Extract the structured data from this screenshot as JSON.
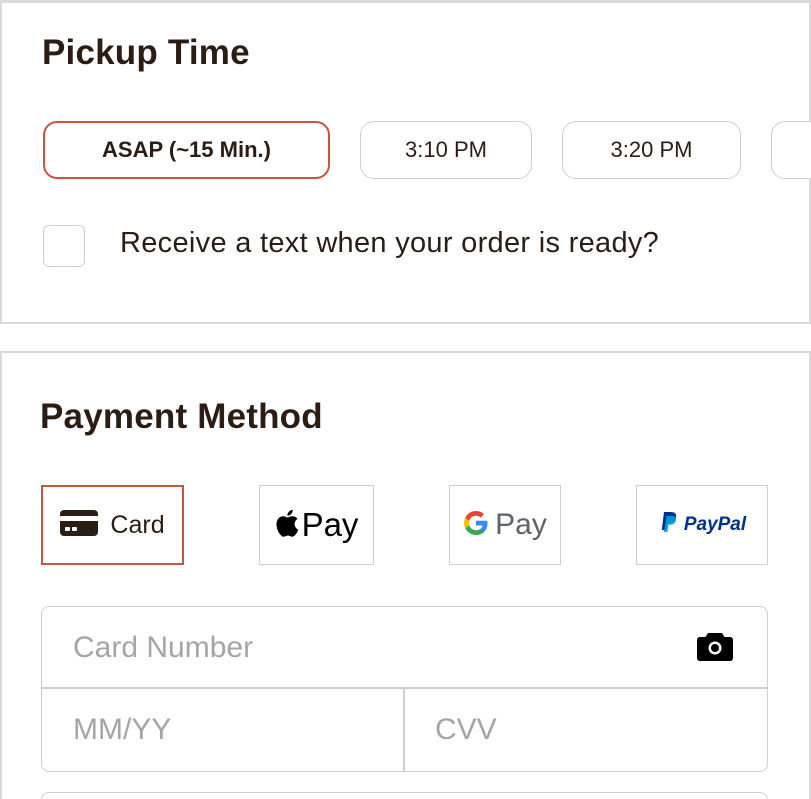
{
  "pickup": {
    "title": "Pickup Time",
    "options": [
      {
        "label": "ASAP (~15 Min.)",
        "selected": true
      },
      {
        "label": "3:10 PM",
        "selected": false
      },
      {
        "label": "3:20 PM",
        "selected": false
      },
      {
        "label": "",
        "selected": false
      }
    ],
    "text_notification_label": "Receive a text when your order is ready?",
    "text_notification_checked": false
  },
  "payment": {
    "title": "Payment Method",
    "methods": [
      {
        "id": "card",
        "label": "Card",
        "icon": "credit-card-icon",
        "selected": true
      },
      {
        "id": "apple_pay",
        "label": "Pay",
        "icon": "apple-logo-icon",
        "selected": false
      },
      {
        "id": "google_pay",
        "label": "Pay",
        "icon": "google-logo-icon",
        "selected": false
      },
      {
        "id": "paypal",
        "label": "PayPal",
        "icon": "paypal-logo-icon",
        "selected": false
      }
    ],
    "card_form": {
      "card_number_placeholder": "Card Number",
      "expiry_placeholder": "MM/YY",
      "cvv_placeholder": "CVV",
      "scan_icon": "camera-icon"
    }
  },
  "colors": {
    "accent": "#c8553d",
    "text": "#2b1d14",
    "border": "#cfcfcf",
    "placeholder": "#a5a5a5",
    "paypal_dark": "#003087",
    "paypal_light": "#009cde"
  }
}
